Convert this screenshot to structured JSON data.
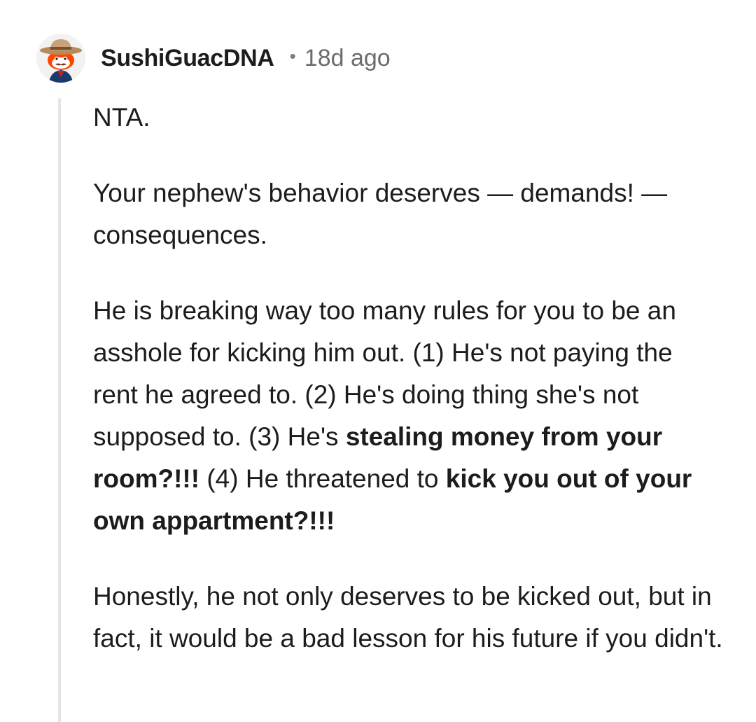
{
  "comment": {
    "author": "SushiGuacDNA",
    "separator": "•",
    "age": "18d ago",
    "avatar_icon": "snoo-cowboy-avatar-icon",
    "paragraphs": [
      {
        "segments": [
          {
            "text": "NTA.",
            "bold": false
          }
        ]
      },
      {
        "segments": [
          {
            "text": "Your nephew's behavior deserves — demands! — consequences.",
            "bold": false
          }
        ]
      },
      {
        "segments": [
          {
            "text": "He is breaking way too many rules for you to be an asshole for kicking him out. (1) He's not paying the rent he agreed to. (2) He's doing thing she's not supposed to. (3) He's ",
            "bold": false
          },
          {
            "text": "stealing money from your room?!!!",
            "bold": true
          },
          {
            "text": " (4) He threatened to ",
            "bold": false
          },
          {
            "text": "kick you out of your own appartment?!!!",
            "bold": true
          }
        ]
      },
      {
        "segments": [
          {
            "text": "Honestly, he not only deserves to be kicked out, but in fact, it would be a bad lesson for his future if you didn't.",
            "bold": false
          }
        ]
      }
    ]
  },
  "colors": {
    "text": "#1c1c1c",
    "meta": "#6c6c6c",
    "thread_line": "#e5e5e5",
    "avatar_orange": "#ff4500",
    "hat_tan": "#c8a27a"
  }
}
